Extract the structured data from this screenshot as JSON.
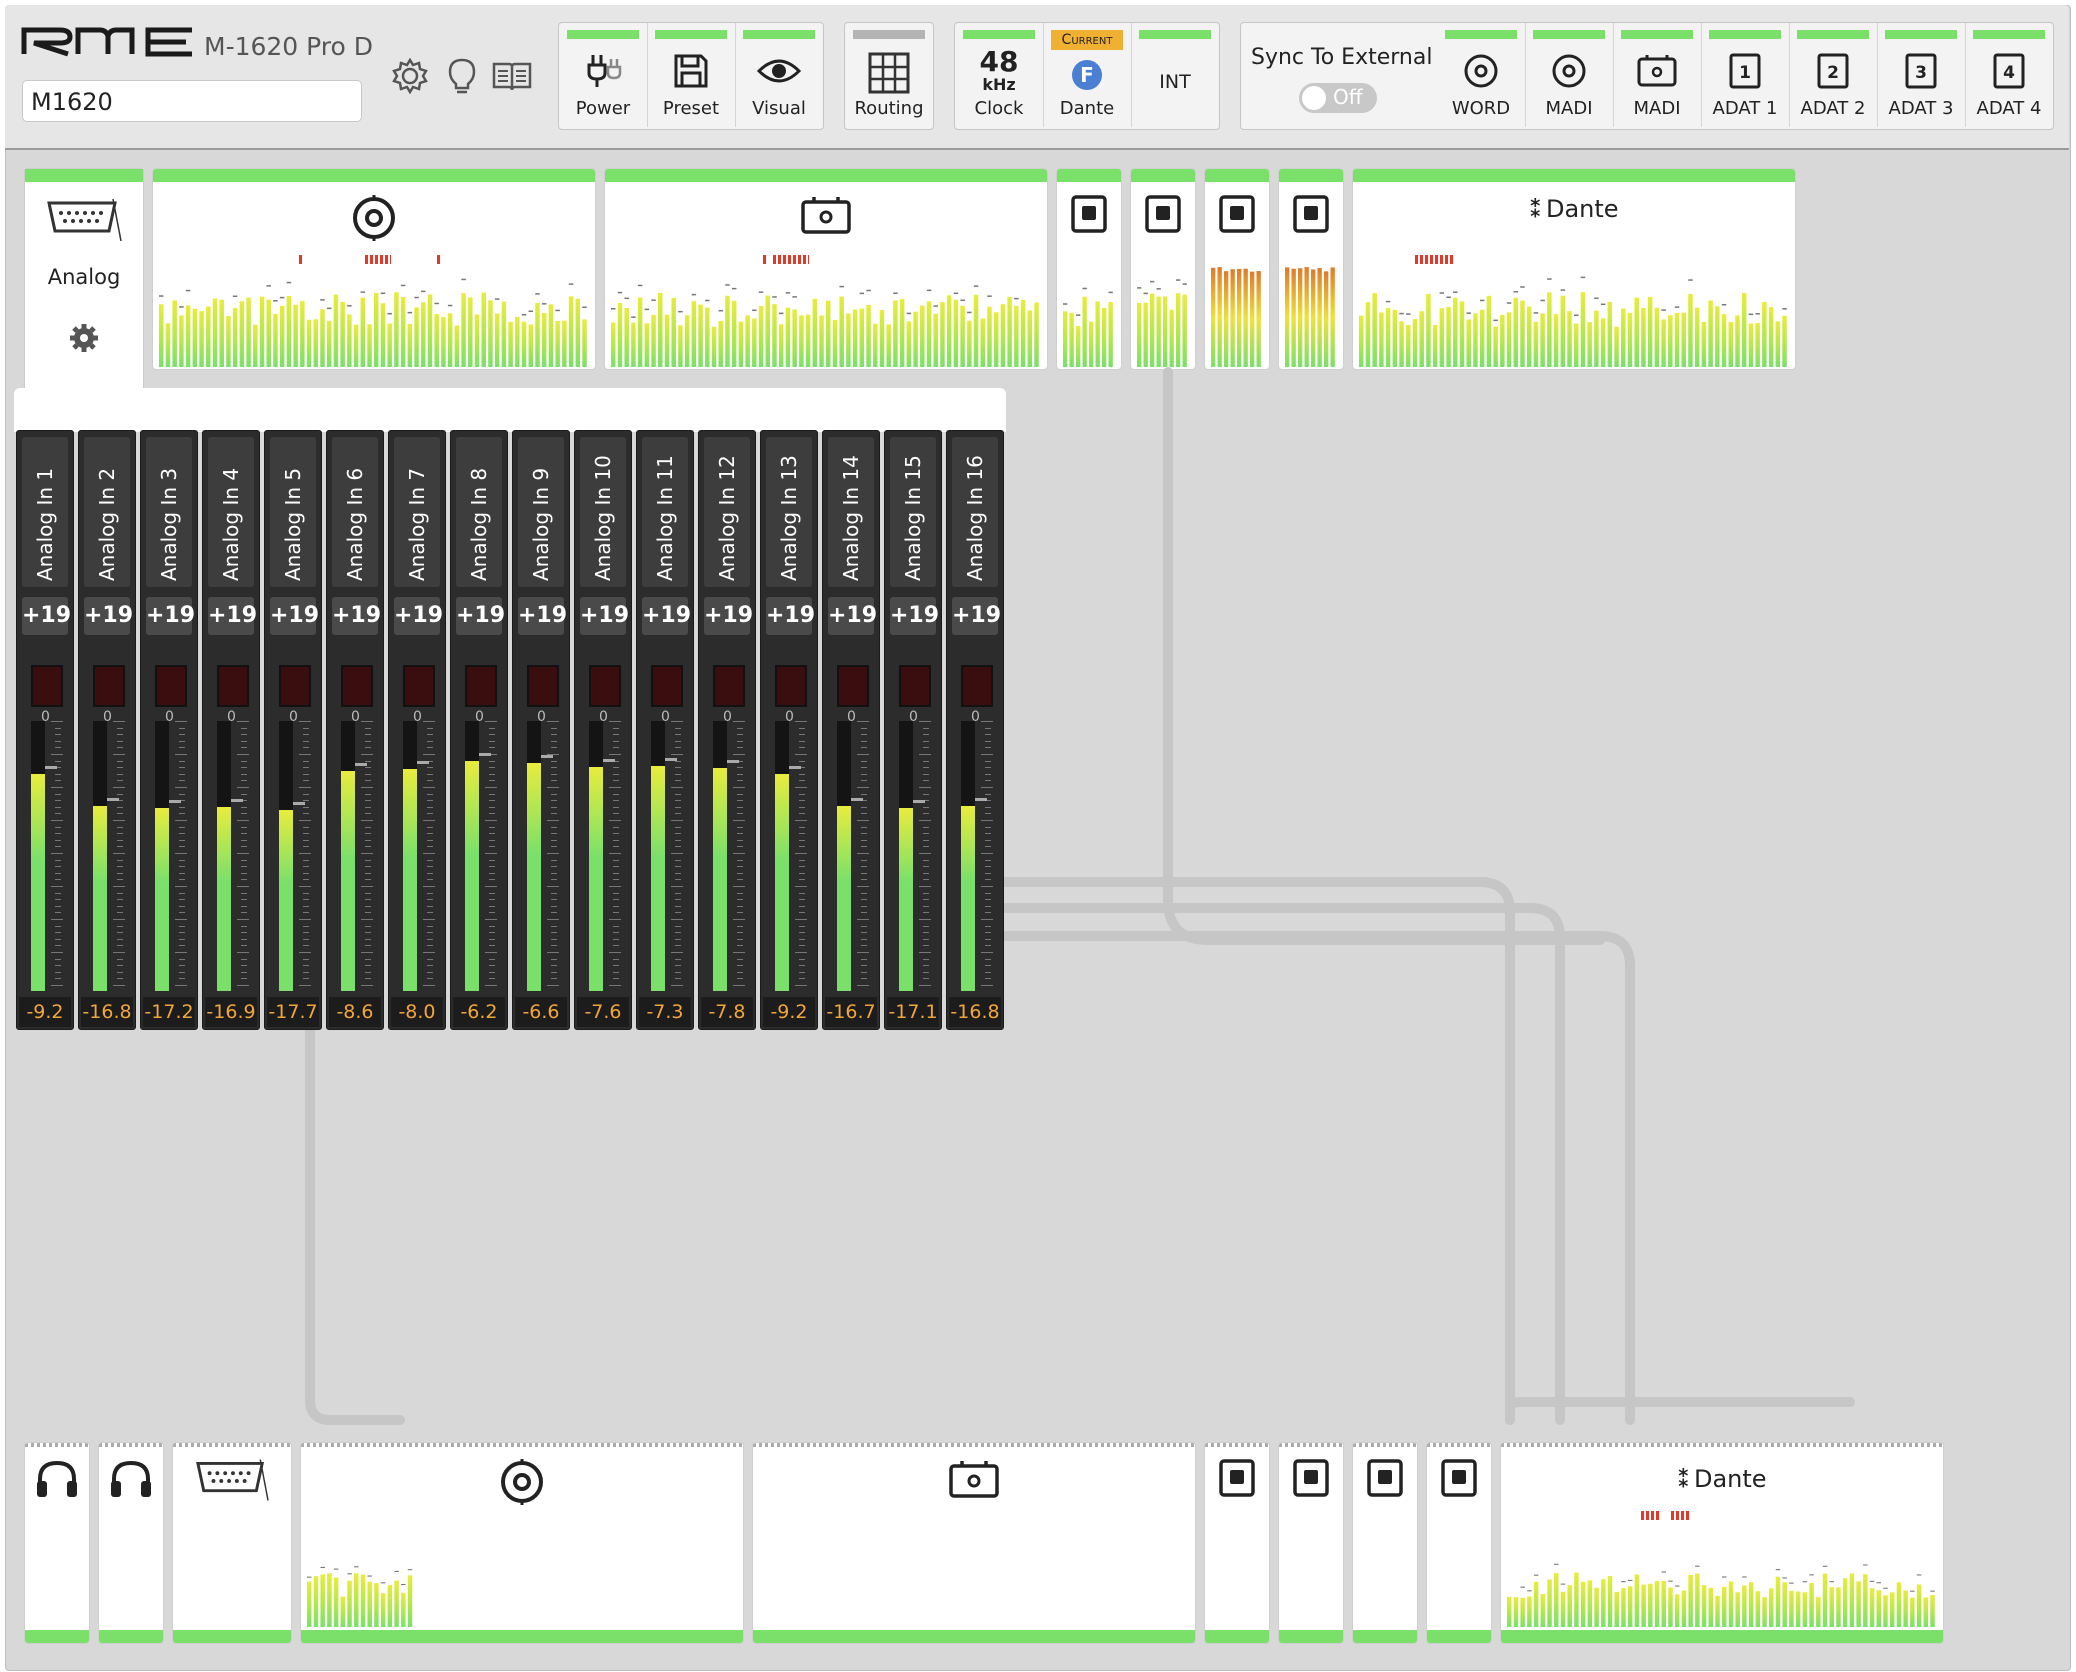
{
  "header": {
    "brand": "RME",
    "model": "M-1620 Pro D",
    "device_name": "M1620",
    "icons": [
      "gear-icon",
      "bulb-icon",
      "manual-icon"
    ]
  },
  "toolbar": {
    "power": "Power",
    "preset": "Preset",
    "visual": "Visual",
    "routing": "Routing",
    "clock_rate": "48",
    "clock_unit": "kHz",
    "clock": "Clock",
    "current_badge": "Current",
    "dante_letter": "F",
    "dante": "Dante",
    "int": "INT",
    "sync_label": "Sync To External",
    "sync_state": "Off",
    "sync_inputs": [
      "WORD",
      "MADI",
      "MADI",
      "ADAT 1",
      "ADAT 2",
      "ADAT 3",
      "ADAT 4"
    ],
    "adat_numbers": [
      "1",
      "2",
      "3",
      "4"
    ]
  },
  "inputs_tab": {
    "label": "Analog"
  },
  "dante_label": "Dante",
  "channels": [
    {
      "name": "Analog In 1",
      "gain": "+19",
      "level": "-9.2"
    },
    {
      "name": "Analog In 2",
      "gain": "+19",
      "level": "-16.8"
    },
    {
      "name": "Analog In 3",
      "gain": "+19",
      "level": "-17.2"
    },
    {
      "name": "Analog In 4",
      "gain": "+19",
      "level": "-16.9"
    },
    {
      "name": "Analog In 5",
      "gain": "+19",
      "level": "-17.7"
    },
    {
      "name": "Analog In 6",
      "gain": "+19",
      "level": "-8.6"
    },
    {
      "name": "Analog In 7",
      "gain": "+19",
      "level": "-8.0"
    },
    {
      "name": "Analog In 8",
      "gain": "+19",
      "level": "-6.2"
    },
    {
      "name": "Analog In 9",
      "gain": "+19",
      "level": "-6.6"
    },
    {
      "name": "Analog In 10",
      "gain": "+19",
      "level": "-7.6"
    },
    {
      "name": "Analog In 11",
      "gain": "+19",
      "level": "-7.3"
    },
    {
      "name": "Analog In 12",
      "gain": "+19",
      "level": "-7.8"
    },
    {
      "name": "Analog In 13",
      "gain": "+19",
      "level": "-9.2"
    },
    {
      "name": "Analog In 14",
      "gain": "+19",
      "level": "-16.7"
    },
    {
      "name": "Analog In 15",
      "gain": "+19",
      "level": "-17.1"
    },
    {
      "name": "Analog In 16",
      "gain": "+19",
      "level": "-16.8"
    }
  ],
  "meter_scale_zero": "0",
  "colors": {
    "led_green": "#7be06a",
    "value_orange": "#f2a63a",
    "current_badge": "#f0b132",
    "dante_blue": "#4a7fd4"
  }
}
